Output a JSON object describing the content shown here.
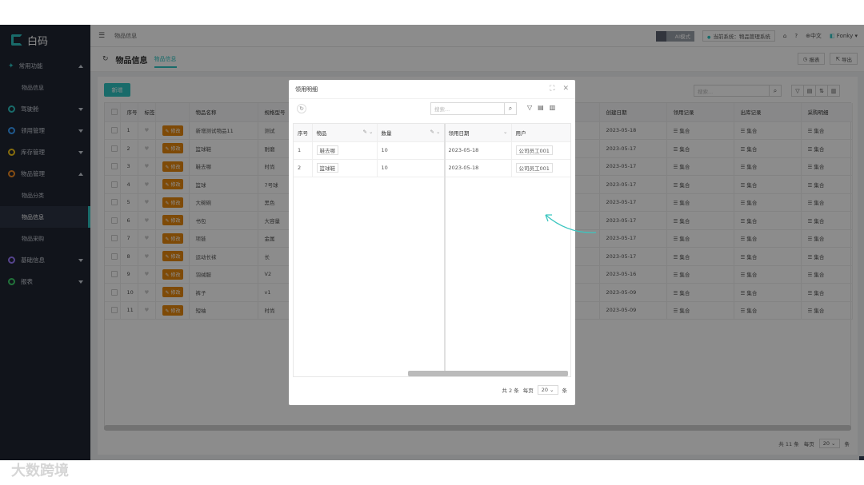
{
  "app": {
    "logo": "白码"
  },
  "sidebar": {
    "items": [
      {
        "label": "常用功能",
        "color": "#2fc4c2",
        "expanded": true
      },
      {
        "label": "物品信息",
        "sub": true
      },
      {
        "label": "驾驶舱",
        "color": "#2fc4c2"
      },
      {
        "label": "领用管理",
        "color": "#3aa0ff"
      },
      {
        "label": "库存管理",
        "color": "#f5c518"
      },
      {
        "label": "物品管理",
        "color": "#f08a24",
        "expanded": true
      },
      {
        "label": "物品分类",
        "sub": true
      },
      {
        "label": "物品信息",
        "sub": true,
        "active": true
      },
      {
        "label": "物品采购",
        "sub": true
      },
      {
        "label": "基础信息",
        "color": "#9b7bff"
      },
      {
        "label": "报表",
        "color": "#3ccf6a"
      }
    ]
  },
  "topbar": {
    "breadcrumb": "物品信息",
    "ai_label": "AI模式",
    "system_label": "当前系统：物品管理系统",
    "lang": "中文",
    "user": "Fonky"
  },
  "page": {
    "title": "物品信息",
    "tab": "物品信息",
    "report_btn": "报表",
    "export_btn": "导出"
  },
  "main": {
    "new_btn": "新增",
    "search_placeholder": "搜索...",
    "columns": [
      "序号",
      "标签",
      "",
      "物品名称",
      "规格型号",
      "",
      "",
      "",
      "",
      "",
      "",
      "创建日期",
      "领用记录",
      "出库记录",
      "采购明细"
    ],
    "edit_label": "修改",
    "link_label": "集合",
    "rows": [
      {
        "no": "1",
        "name": "新增测试物品11",
        "spec": "测试",
        "date": "2023-05-18"
      },
      {
        "no": "2",
        "name": "篮球鞋",
        "spec": "耐磨",
        "date": "2023-05-17"
      },
      {
        "no": "3",
        "name": "鞋去哪",
        "spec": "时尚",
        "date": "2023-05-17"
      },
      {
        "no": "4",
        "name": "篮球",
        "spec": "7号球",
        "date": "2023-05-17"
      },
      {
        "no": "5",
        "name": "大碗碗",
        "spec": "黑色",
        "date": "2023-05-17"
      },
      {
        "no": "6",
        "name": "书包",
        "spec": "大容量",
        "date": "2023-05-17"
      },
      {
        "no": "7",
        "name": "项链",
        "spec": "金属",
        "date": "2023-05-17"
      },
      {
        "no": "8",
        "name": "运动长袜",
        "spec": "长",
        "date": "2023-05-17"
      },
      {
        "no": "9",
        "name": "羽绒服",
        "spec": "V2",
        "date": "2023-05-16"
      },
      {
        "no": "10",
        "name": "裤子",
        "spec": "v1",
        "date": "2023-05-09"
      },
      {
        "no": "11",
        "name": "短袖",
        "spec": "时尚",
        "date": "2023-05-09"
      }
    ],
    "pager": {
      "total": "共 11 条",
      "per_page_label": "每页",
      "per_page": "20",
      "unit": "条"
    }
  },
  "modal": {
    "title": "领用明细",
    "search_placeholder": "搜索...",
    "columns": [
      "序号",
      "物品",
      "数量",
      "领用日期",
      "用户"
    ],
    "rows": [
      {
        "no": "1",
        "item": "鞋去哪",
        "qty": "10",
        "date": "2023-05-18",
        "user": "公司员工001"
      },
      {
        "no": "2",
        "item": "篮球鞋",
        "qty": "10",
        "date": "2023-05-18",
        "user": "公司员工001"
      }
    ],
    "pager": {
      "total": "共 2 条",
      "per_page_label": "每页",
      "per_page": "20",
      "unit": "条"
    }
  },
  "watermark": "大数跨境"
}
